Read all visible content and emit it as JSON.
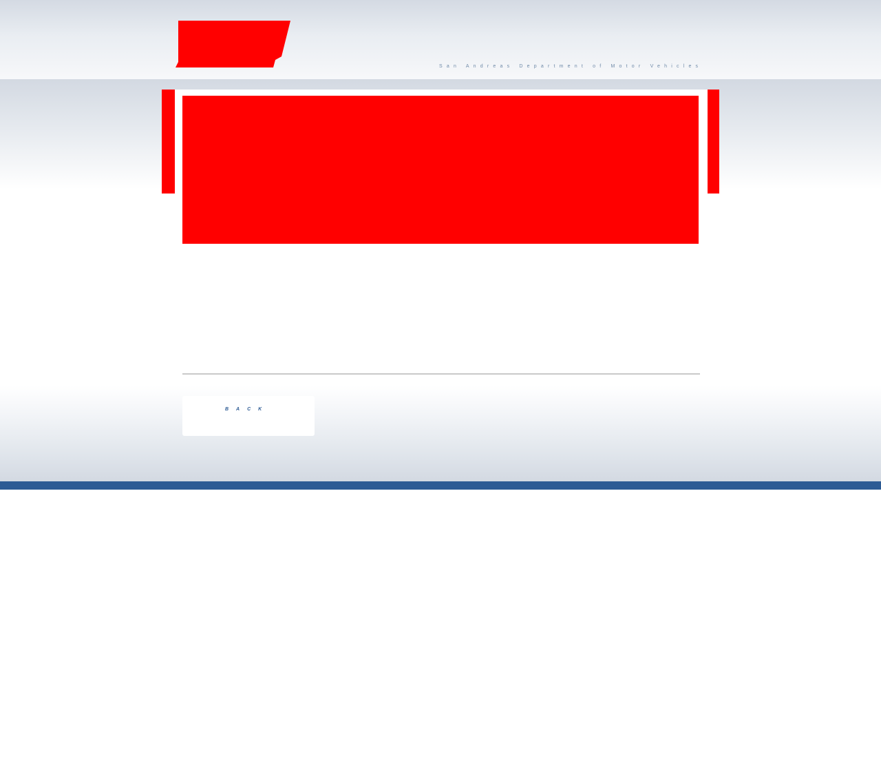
{
  "header": {
    "tagline": "San Andreas Department of Motor Vehicles",
    "logo_icon": "dmv-logo-icon"
  },
  "main": {
    "banner_icon": "banner-image-placeholder"
  },
  "actions": {
    "back_label": "BACK"
  },
  "colors": {
    "placeholder_red": "#ff0000",
    "accent_blue": "#2d5b94",
    "tagline_blue": "#6f8aa8",
    "divider_gray": "#c9c9c9"
  }
}
